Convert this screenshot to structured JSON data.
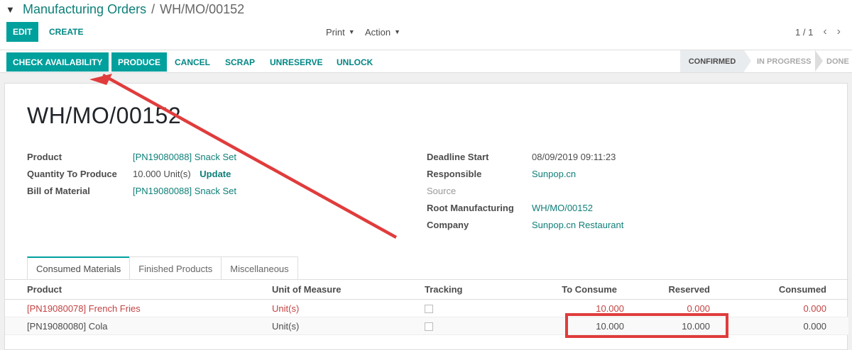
{
  "breadcrumb": {
    "parent": "Manufacturing Orders",
    "separator": "/",
    "current": "WH/MO/00152"
  },
  "toolbar": {
    "edit": "EDIT",
    "create": "CREATE",
    "print": "Print",
    "action": "Action",
    "pager": "1 / 1",
    "prev": "‹",
    "next": "›"
  },
  "statusbar": {
    "buttons": {
      "check_availability": "CHECK AVAILABILITY",
      "produce": "PRODUCE",
      "cancel": "CANCEL",
      "scrap": "SCRAP",
      "unreserve": "UNRESERVE",
      "unlock": "UNLOCK"
    },
    "stages": {
      "confirmed": "CONFIRMED",
      "in_progress": "IN PROGRESS",
      "done": "DONE"
    }
  },
  "record": {
    "name": "WH/MO/00152",
    "left": {
      "product_label": "Product",
      "product": "[PN19080088] Snack Set",
      "qty_label": "Quantity To Produce",
      "qty": "10.000",
      "qty_uom": "Unit(s)",
      "update": "Update",
      "bom_label": "Bill of Material",
      "bom": "[PN19080088] Snack Set"
    },
    "right": {
      "deadline_label": "Deadline Start",
      "deadline": "08/09/2019 09:11:23",
      "responsible_label": "Responsible",
      "responsible": "Sunpop.cn",
      "source_label": "Source",
      "root_label": "Root Manufacturing",
      "root": "WH/MO/00152",
      "company_label": "Company",
      "company": "Sunpop.cn Restaurant"
    }
  },
  "tabs": {
    "consumed": "Consumed Materials",
    "finished": "Finished Products",
    "misc": "Miscellaneous"
  },
  "table": {
    "headers": {
      "product": "Product",
      "uom": "Unit of Measure",
      "tracking": "Tracking",
      "to_consume": "To Consume",
      "reserved": "Reserved",
      "consumed": "Consumed"
    },
    "rows": [
      {
        "product": "[PN19080078] French Fries",
        "uom": "Unit(s)",
        "to_consume": "10.000",
        "reserved": "0.000",
        "consumed": "0.000"
      },
      {
        "product": "[PN19080080] Cola",
        "uom": "Unit(s)",
        "to_consume": "10.000",
        "reserved": "10.000",
        "consumed": "0.000"
      }
    ]
  },
  "colors": {
    "accent": "#00a09d",
    "link": "#0e7f78",
    "annotation_red": "#e03c3c",
    "shortage_red": "#c34343"
  }
}
